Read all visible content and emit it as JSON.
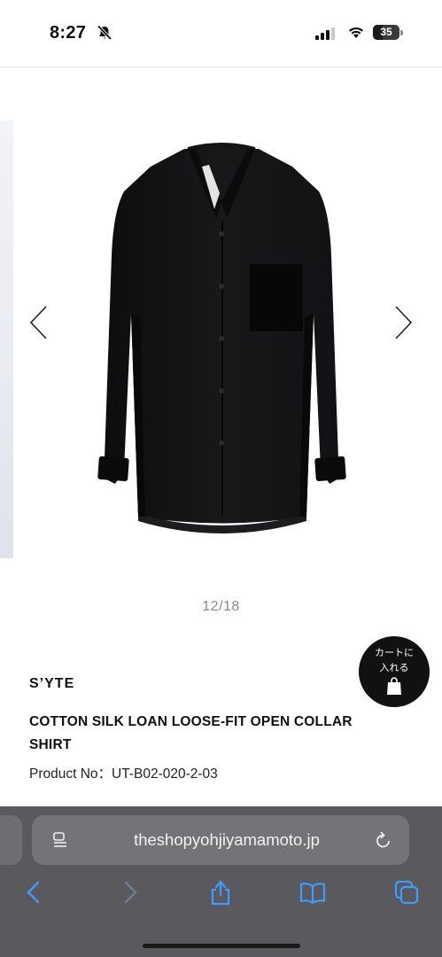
{
  "status_bar": {
    "time": "8:27",
    "battery_level": "35",
    "icons": [
      "bell-slash-icon",
      "cellular-signal-icon",
      "wifi-icon",
      "battery-icon"
    ]
  },
  "carousel": {
    "current": 12,
    "total": 18,
    "counter_text": "12/18",
    "image": "black-open-collar-shirt",
    "prev_icon": "chevron-left-icon",
    "next_icon": "chevron-right-icon"
  },
  "product": {
    "brand": "S’YTE",
    "title": "COTTON SILK LOAN LOOSE-FIT OPEN COLLAR SHIRT",
    "product_no": "Product No：UT-B02-020-2-03"
  },
  "cart_button": {
    "line1": "カートに",
    "line2": "入れる",
    "icon": "shopping-bag-icon"
  },
  "browser": {
    "url": "theshopyohjiyamamoto.jp",
    "toolbar": [
      "back-icon",
      "forward-icon",
      "share-icon",
      "bookmarks-icon",
      "tabs-icon"
    ]
  },
  "colors": {
    "accent": "#3a9cff",
    "cart_bg": "#111111",
    "browser_bg": "#5a5a5e",
    "address_bg": "#747478",
    "counter_text": "#8a8a8a"
  }
}
